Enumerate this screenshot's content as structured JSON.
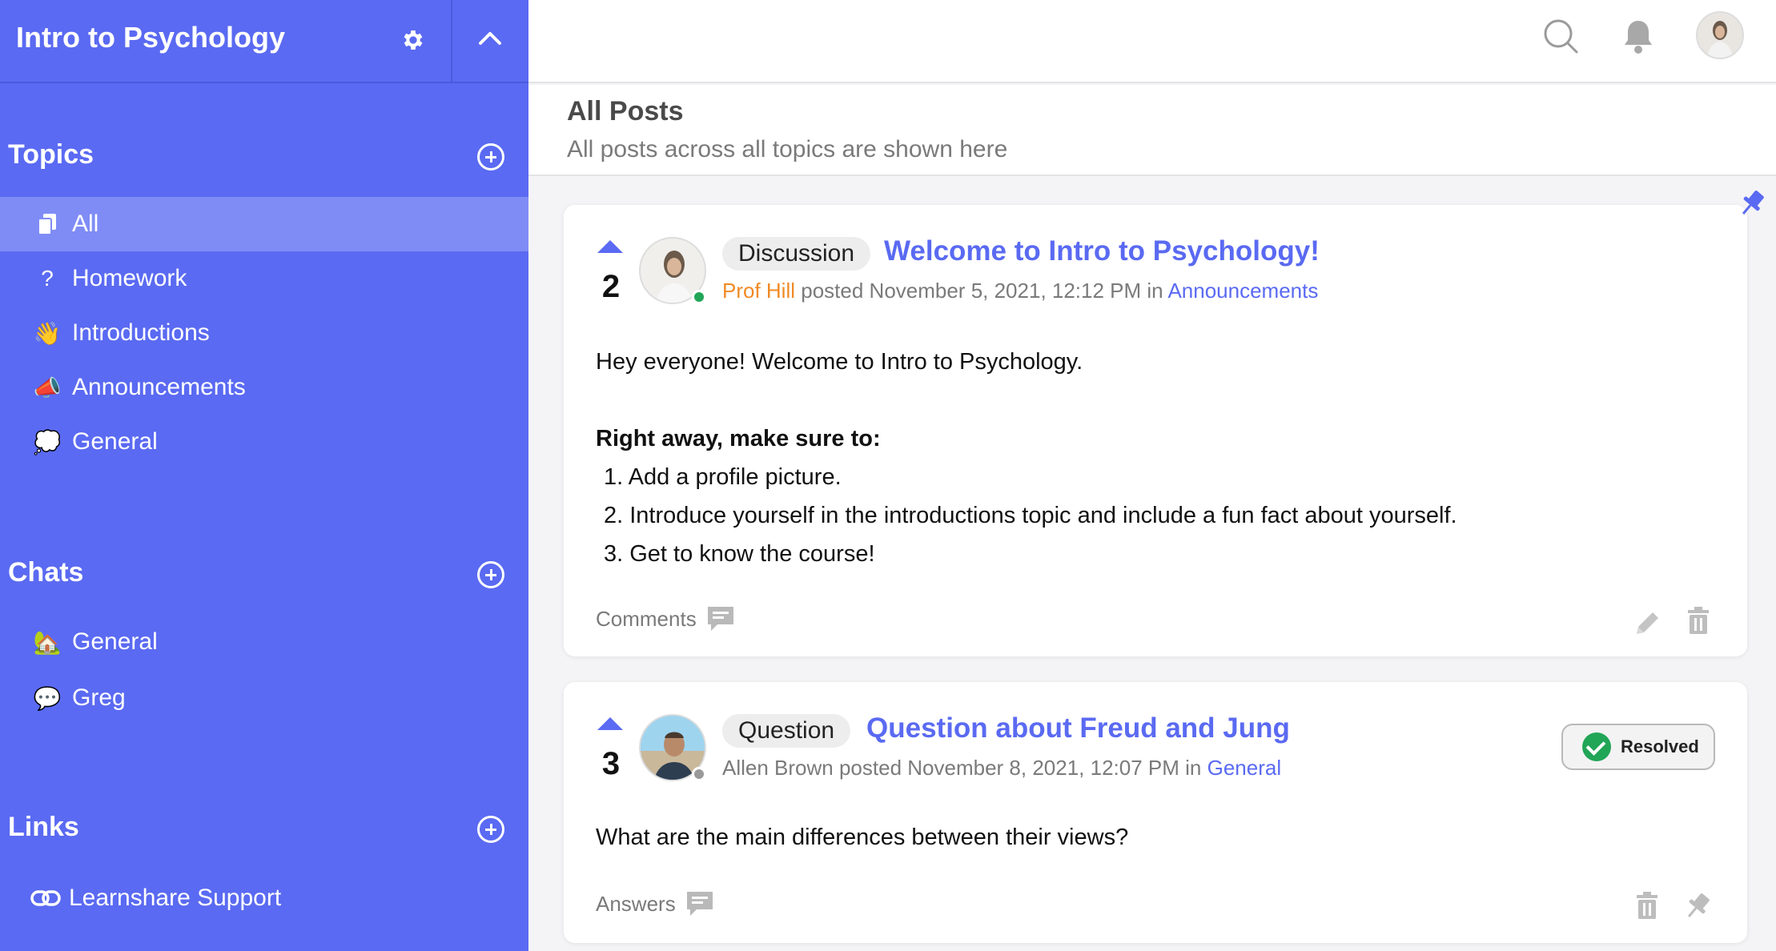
{
  "course": {
    "title": "Intro to Psychology"
  },
  "sidebar": {
    "topics_title": "Topics",
    "topics": [
      {
        "label": "All",
        "icon": "copy-icon"
      },
      {
        "label": "Homework",
        "icon": "question-icon"
      },
      {
        "label": "Introductions",
        "icon": "wave-icon"
      },
      {
        "label": "Announcements",
        "icon": "megaphone-icon"
      },
      {
        "label": "General",
        "icon": "thought-bubble-icon"
      }
    ],
    "chats_title": "Chats",
    "chats": [
      {
        "label": "General",
        "icon": "house-icon"
      },
      {
        "label": "Greg",
        "icon": "chat-bubble-icon"
      }
    ],
    "links_title": "Links",
    "links": [
      {
        "label": "Learnshare Support",
        "icon": "link-icon"
      }
    ]
  },
  "main": {
    "title": "All Posts",
    "subtitle": "All posts across all topics are shown here"
  },
  "posts": [
    {
      "votes": "2",
      "tag": "Discussion",
      "title": "Welcome to Intro to Psychology!",
      "author": "Prof Hill",
      "posted": "posted November 5, 2021, 12:12 PM in",
      "topic": "Announcements",
      "body_intro": "Hey everyone! Welcome to Intro to Psychology.",
      "body_bold": "Right away, make sure to:",
      "list": [
        "1. Add a profile picture.",
        "2. Introduce yourself in the introductions topic and include a fun fact about yourself.",
        "3. Get to know the course!"
      ],
      "footer_label": "Comments",
      "pinned": true
    },
    {
      "votes": "3",
      "tag": "Question",
      "title": "Question about Freud and Jung",
      "author": "Allen Brown",
      "posted": "posted November 8, 2021, 12:07 PM in",
      "topic": "General",
      "body": "What are the main differences between their views?",
      "footer_label": "Answers",
      "resolved_label": "Resolved"
    }
  ],
  "colors": {
    "accent": "#5a6af2",
    "sidebar_active": "#7f8cf6",
    "author_orange": "#f08a24",
    "online_green": "#21a556"
  }
}
